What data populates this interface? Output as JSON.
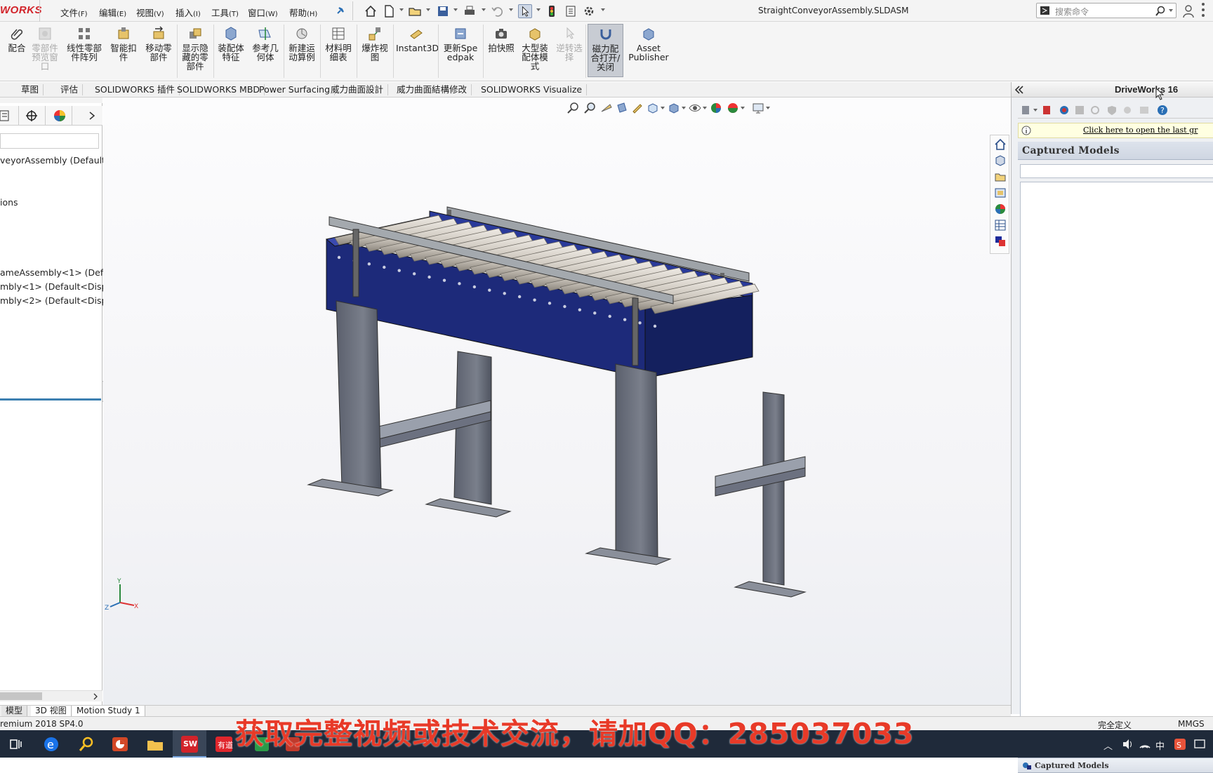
{
  "app": {
    "logo_text": "WORKS",
    "window_title": "StraightConveyorAssembly.SLDASM"
  },
  "menubar": [
    {
      "label": "文件",
      "key": "(F)"
    },
    {
      "label": "编辑",
      "key": "(E)"
    },
    {
      "label": "视图",
      "key": "(V)"
    },
    {
      "label": "插入",
      "key": "(I)"
    },
    {
      "label": "工具",
      "key": "(T)"
    },
    {
      "label": "窗口",
      "key": "(W)"
    },
    {
      "label": "帮助",
      "key": "(H)"
    }
  ],
  "search": {
    "placeholder": "搜索命令"
  },
  "ribbon": [
    {
      "label": "配合",
      "enabled": true
    },
    {
      "label": "零部件预览窗口",
      "enabled": false
    },
    {
      "label": "线性零部件阵列",
      "enabled": true
    },
    {
      "label": "智能扣件",
      "enabled": true
    },
    {
      "label": "移动零部件",
      "enabled": true
    },
    {
      "label": "显示隐藏的零部件",
      "enabled": true
    },
    {
      "label": "装配体特征",
      "enabled": true
    },
    {
      "label": "参考几何体",
      "enabled": true
    },
    {
      "label": "新建运动算例",
      "enabled": true
    },
    {
      "label": "材料明细表",
      "enabled": true
    },
    {
      "label": "爆炸视图",
      "enabled": true
    },
    {
      "label": "Instant3D",
      "enabled": true
    },
    {
      "label": "更新Speedpak",
      "enabled": true
    },
    {
      "label": "拍快照",
      "enabled": true
    },
    {
      "label": "大型装配体模式",
      "enabled": true
    },
    {
      "label": "逆转选择",
      "enabled": false
    },
    {
      "label": "磁力配合打开/关闭",
      "enabled": true,
      "active": true
    },
    {
      "label": "Asset Publisher",
      "enabled": true
    }
  ],
  "command_tabs": [
    "草图",
    "评估",
    "SOLIDWORKS 插件",
    "SOLIDWORKS MBD",
    "Power Surfacing",
    "威力曲面設計",
    "威力曲面結構修改",
    "SOLIDWORKS Visualize"
  ],
  "feature_tree": {
    "root": "veyorAssembly  (Default<",
    "items": [
      "ions",
      "ameAssembly<1> (Defau",
      "mbly<1> (Default<Displ",
      "mbly<2> (Default<Displ"
    ]
  },
  "driveworks": {
    "title": "DriveWorks 16",
    "info_link": "Click here to open the last gr",
    "captured_models_header": "Captured Models",
    "captured_models_footer": "Captured Models"
  },
  "bottom_tabs": [
    "模型",
    "3D 视图",
    "Motion Study 1"
  ],
  "status": {
    "left": "remium 2018 SP4.0",
    "state": "完全定义",
    "units": "MMGS"
  },
  "tray": {
    "ime": "中"
  },
  "watermark": "获取完整视频或技术交流，请加QQ：285037033",
  "colors": {
    "conveyor_frame": "#1d2a7a",
    "legs": "#6c7180",
    "rollers": "#d6d2cc",
    "accent_red": "#e83a28"
  }
}
